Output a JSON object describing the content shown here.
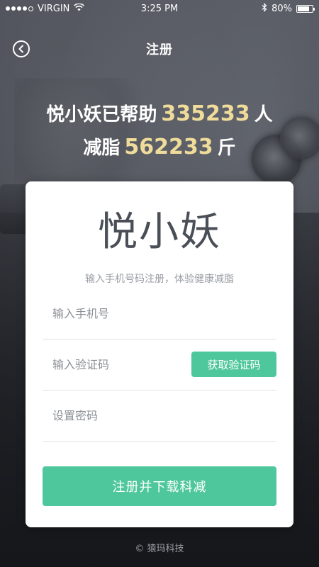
{
  "status_bar": {
    "carrier": "VIRGIN",
    "signal_icon": "signal-dots-icon",
    "wifi_icon": "wifi-icon",
    "time": "3:25 PM",
    "bluetooth_icon": "bluetooth-icon",
    "battery_text": "80%",
    "battery_level": 0.8
  },
  "nav": {
    "title": "注册",
    "back_icon": "back-arrow-circle-icon"
  },
  "stats": {
    "line1_prefix": "悦小妖已帮助",
    "line1_number": "335233",
    "line1_suffix": "人",
    "line2_prefix": "减脂",
    "line2_number": "562233",
    "line2_suffix": "斤"
  },
  "card": {
    "logo": "悦小妖",
    "tagline": "输入手机号码注册，体验健康减脂",
    "phone_placeholder": "输入手机号",
    "code_placeholder": "输入验证码",
    "get_code_label": "获取验证码",
    "password_placeholder": "设置密码",
    "submit_label": "注册并下载科减"
  },
  "footer": {
    "copyright": "© 猿玛科技"
  },
  "colors": {
    "accent": "#4fc79d",
    "highlight_number": "#f0dc9a"
  }
}
